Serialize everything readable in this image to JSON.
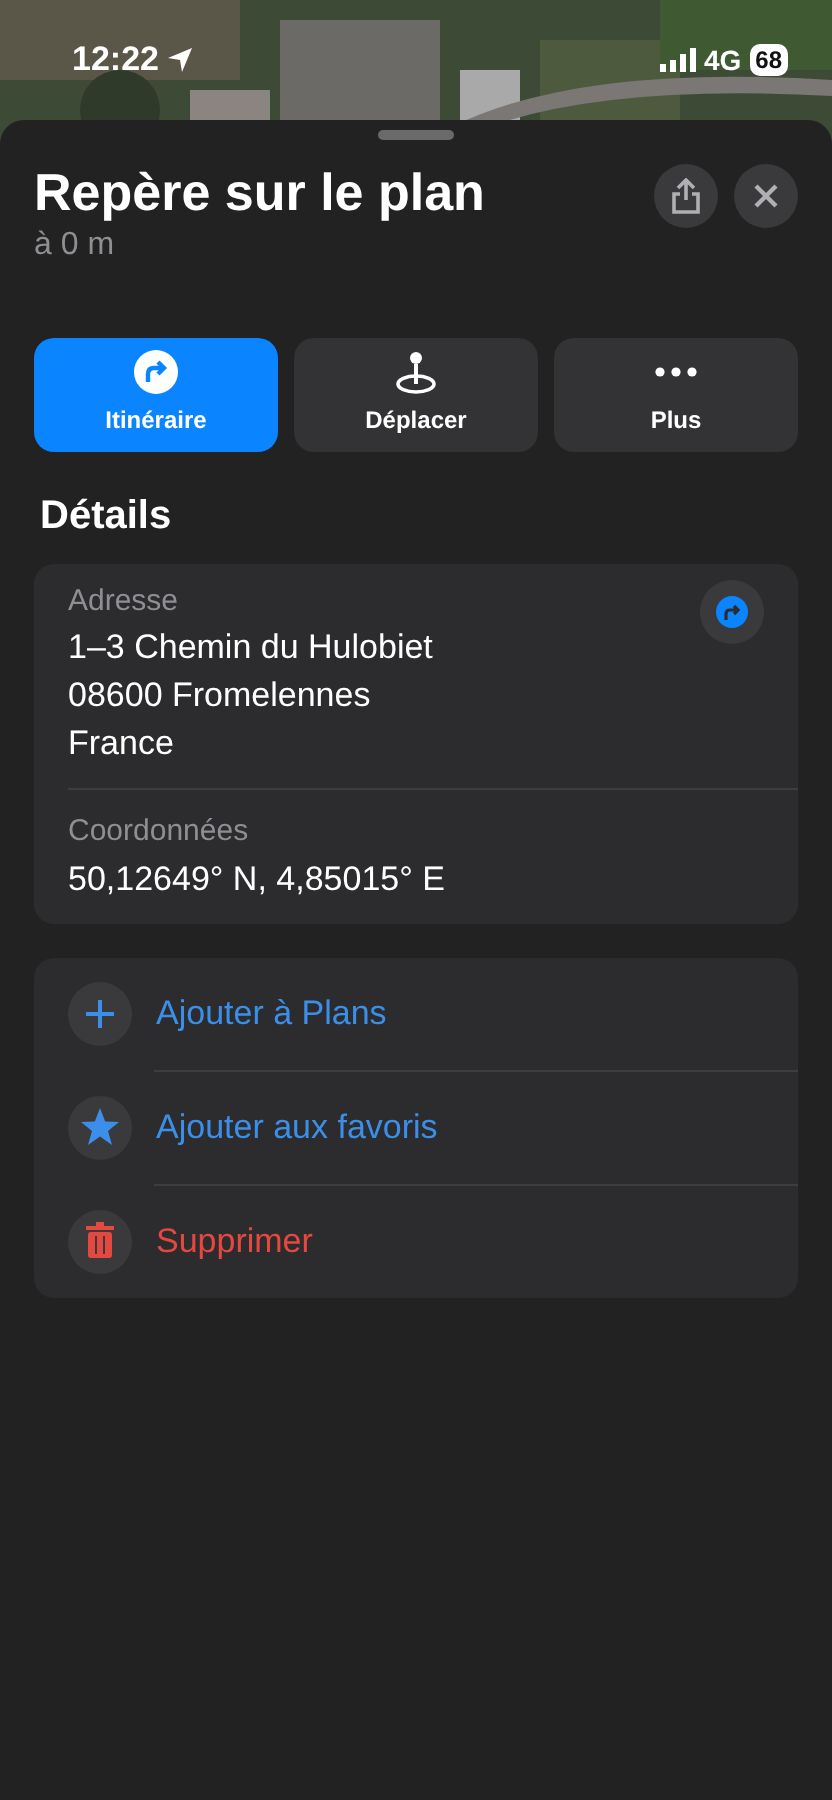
{
  "status_bar": {
    "time": "12:22",
    "network": "4G",
    "battery": "68"
  },
  "sheet": {
    "title": "Repère sur le plan",
    "subtitle": "à 0 m"
  },
  "actions": [
    {
      "kind": "route",
      "label": "Itinéraire",
      "prominent": true
    },
    {
      "kind": "move",
      "label": "Déplacer",
      "prominent": false
    },
    {
      "kind": "more",
      "label": "Plus",
      "prominent": false
    }
  ],
  "details": {
    "heading": "Détails",
    "fields": [
      {
        "label": "Adresse",
        "lines": [
          "1–3 Chemin du Hulobiet",
          "08600 Fromelennes",
          "France"
        ],
        "has_route_button": true
      },
      {
        "label": "Coordonnées",
        "lines": [
          "50,12649° N, 4,85015° E"
        ],
        "has_route_button": false
      }
    ]
  },
  "menu": [
    {
      "kind": "add",
      "label": "Ajouter à Plans",
      "color": "#3b8fe8"
    },
    {
      "kind": "favorite",
      "label": "Ajouter aux favoris",
      "color": "#3b8fe8"
    },
    {
      "kind": "delete",
      "label": "Supprimer",
      "color": "#e5483f"
    }
  ]
}
